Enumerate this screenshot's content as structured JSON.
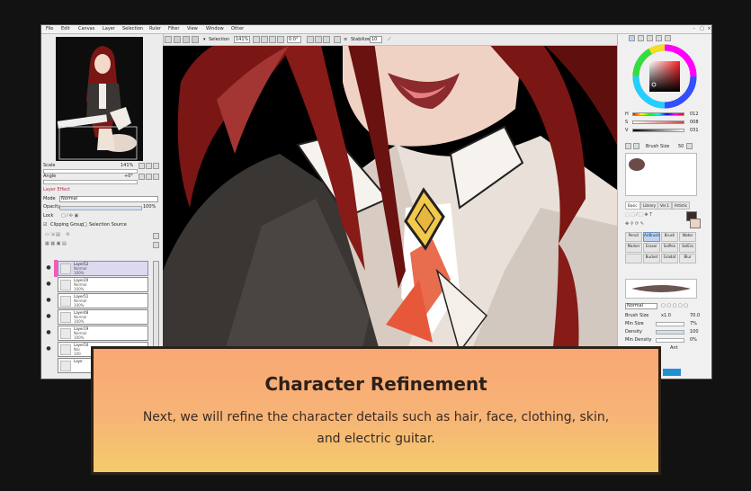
{
  "menubar": {
    "items": [
      "File",
      "Edit",
      "Canvas",
      "Layer",
      "Selection",
      "Ruler",
      "Filter",
      "View",
      "Window",
      "Other"
    ]
  },
  "toolbar": {
    "selection_label": "Selection",
    "zoom_value": "141%",
    "rotation_value": "0.0°",
    "stabilizer_label": "Stabilizer",
    "stabilizer_value": "10"
  },
  "navigator": {
    "scale_label": "Scale",
    "scale_value": "141%",
    "angle_label": "Angle",
    "angle_value": "+0°"
  },
  "layer_panel": {
    "effect_label": "Layer Effect",
    "mode_label": "Mode",
    "mode_value": "Normal",
    "opacity_label": "Opacity",
    "opacity_value": "100%",
    "lock_label": "Lock",
    "clipping_label": "Clipping Group",
    "selection_source_label": "Selection Source",
    "layers": [
      {
        "name": "Layer52",
        "mode": "Normal",
        "opacity": "100%",
        "selected": true
      },
      {
        "name": "Layer20",
        "mode": "Normal",
        "opacity": "100%",
        "selected": false
      },
      {
        "name": "Layer51",
        "mode": "Normal",
        "opacity": "100%",
        "selected": false
      },
      {
        "name": "Layer48",
        "mode": "Normal",
        "opacity": "100%",
        "selected": false
      },
      {
        "name": "Layer19",
        "mode": "Normal",
        "opacity": "100%",
        "selected": false
      },
      {
        "name": "Layer50",
        "mode": "Nor",
        "opacity": "100",
        "selected": false
      },
      {
        "name": "Laye",
        "mode": "",
        "opacity": "",
        "selected": false
      }
    ]
  },
  "color_panel": {
    "h_label": "H",
    "h_value": "012",
    "s_label": "S",
    "s_value": "008",
    "v_label": "V",
    "v_value": "031"
  },
  "brush_panel": {
    "size_label": "Brush Size",
    "size_value": "50",
    "tabs": [
      "Basic",
      "Library",
      "Ver.1",
      "Artistic"
    ],
    "tools": [
      [
        "Pencil",
        "AirBrush",
        "Brush",
        "Water"
      ],
      [
        "Marker",
        "Eraser",
        "SelPen",
        "SelEra"
      ],
      [
        "",
        "Bucket",
        "Gradat",
        "Blur"
      ]
    ],
    "blend_mode": "Normal",
    "brush_size_label": "Brush Size",
    "brush_size_multiplier": "x1.0",
    "brush_size_value": "70.0",
    "min_size_label": "Min Size",
    "min_size_value": "7%",
    "density_label": "Density",
    "density_value": "100",
    "min_density_label": "Min Density",
    "min_density_value": "0%",
    "extra_value": "Ant"
  },
  "overlay": {
    "title": "Character Refinement",
    "body": "Next, we will refine the character details such as hair, face, clothing, skin, and electric guitar."
  },
  "colors": {
    "overlay_gradient_top": "#f9a774",
    "overlay_gradient_bottom": "#f3cb6b",
    "overlay_border": "#2e2116",
    "layer_highlight": "#f45bb6",
    "hair": "#7a1614",
    "suit": "#3a3633"
  }
}
